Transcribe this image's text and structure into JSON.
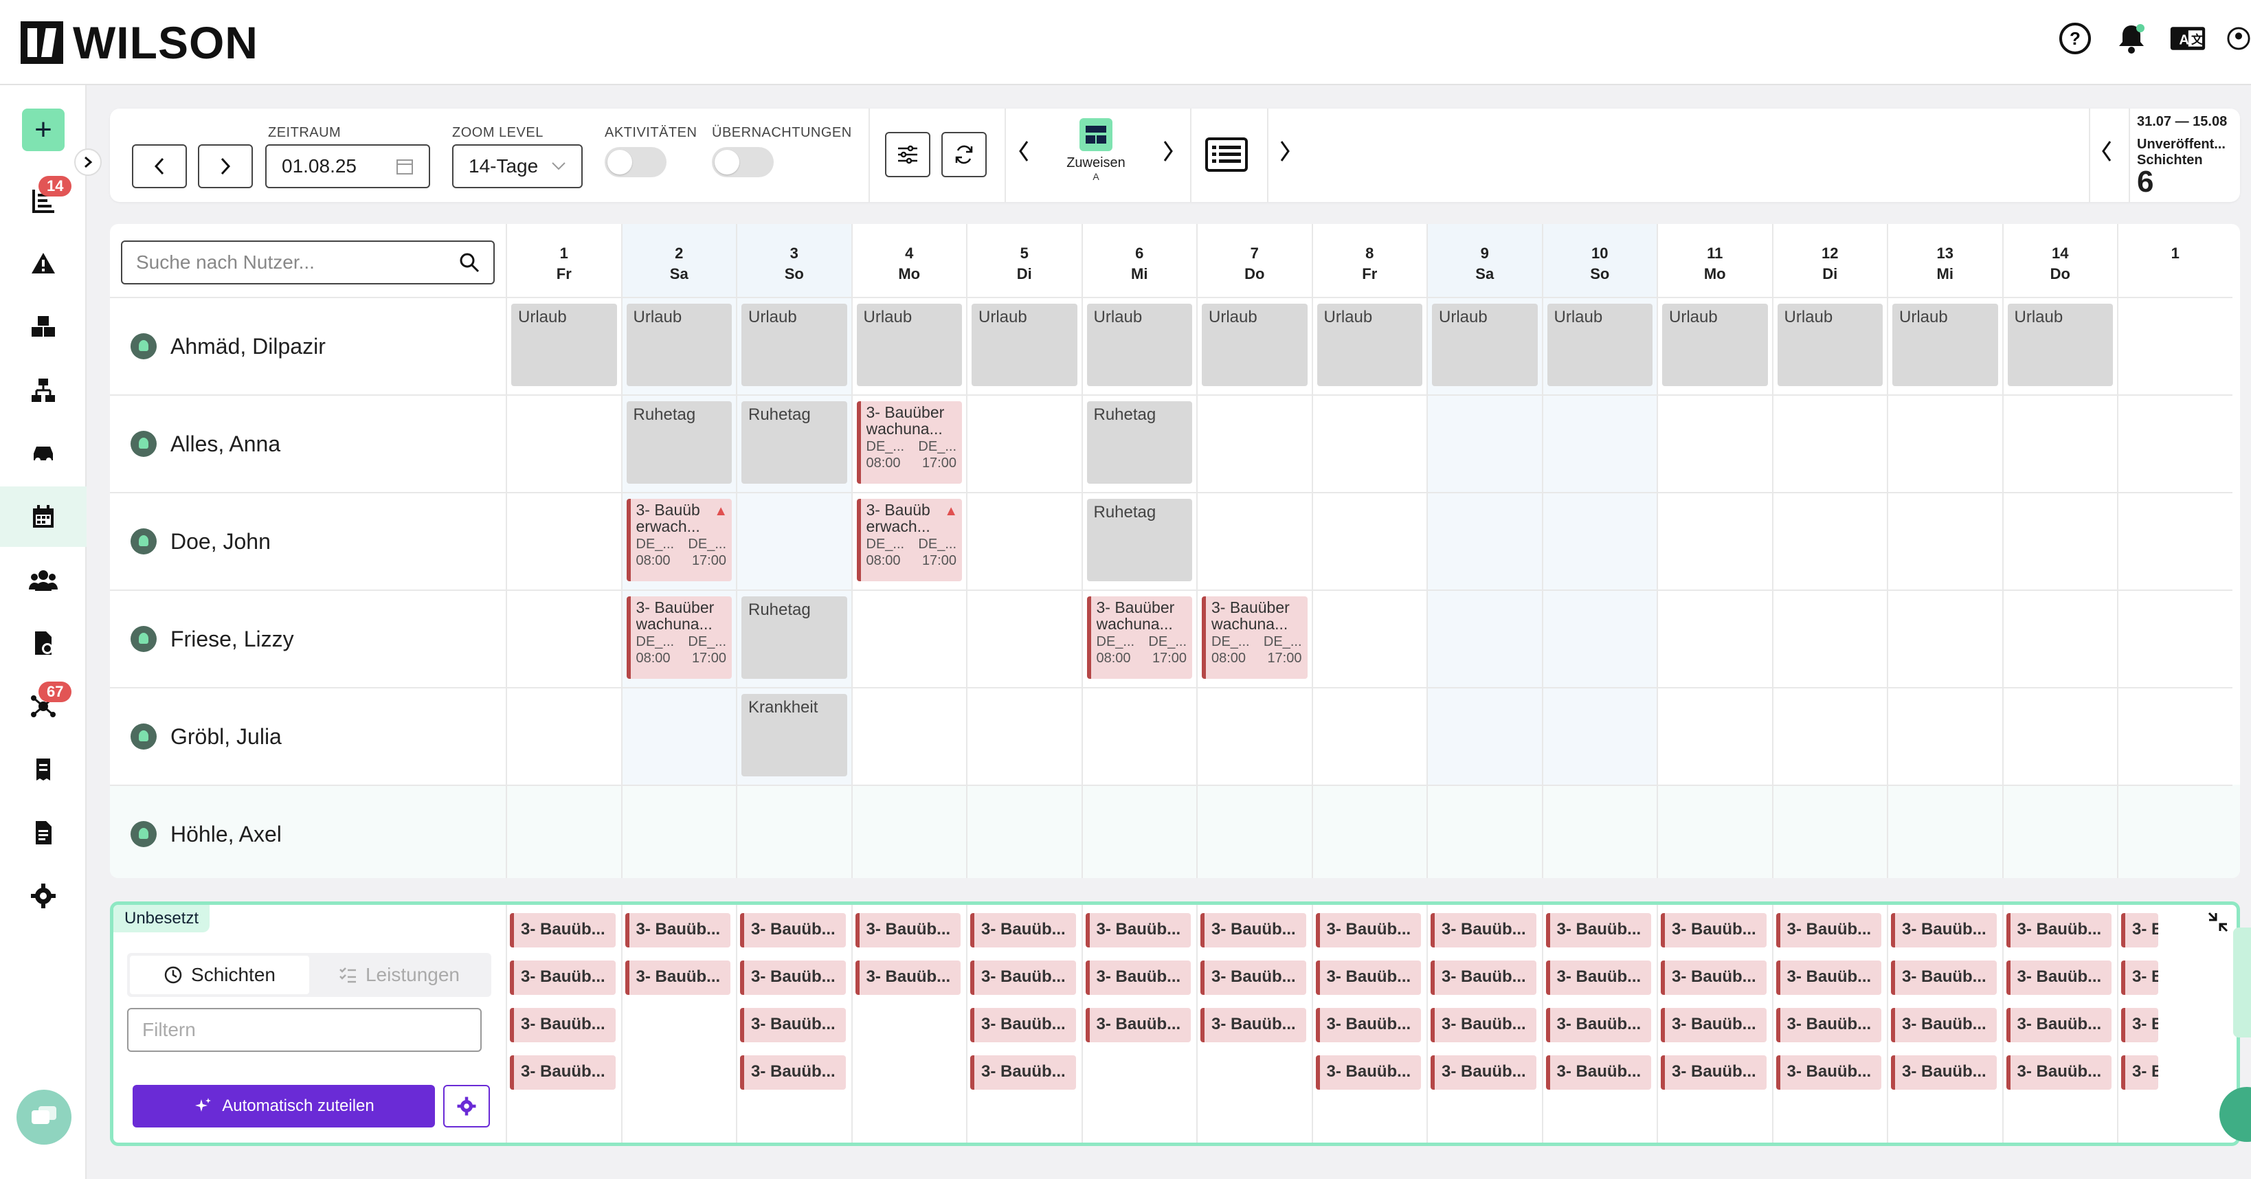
{
  "brand": {
    "name": "WILSON"
  },
  "header": {
    "icons": [
      "help-icon",
      "bell-icon",
      "translate-icon",
      "user-icon"
    ]
  },
  "sidebar": {
    "add_label": "+",
    "badges": {
      "timesheets": "14",
      "connections": "67"
    }
  },
  "toolbar": {
    "zeitraum_label": "ZEITRAUM",
    "zeitraum_value": "01.08.25",
    "zoom_label": "ZOOM LEVEL",
    "zoom_value": "14-Tage",
    "aktivitaeten_label": "AKTIVITÄTEN",
    "uebernachtungen_label": "ÜBERNACHTUNGEN",
    "zuweisen_label": "Zuweisen",
    "zuweisen_sub": "A",
    "period_range": "31.07 — 15.08",
    "unpublished_label": "Unveröffent...",
    "unpublished_sub": "Schichten",
    "unpublished_count": "6"
  },
  "grid": {
    "search_placeholder": "Suche nach Nutzer...",
    "days": [
      {
        "num": "1",
        "wd": "Fr",
        "we": false
      },
      {
        "num": "2",
        "wd": "Sa",
        "we": true
      },
      {
        "num": "3",
        "wd": "So",
        "we": true
      },
      {
        "num": "4",
        "wd": "Mo",
        "we": false
      },
      {
        "num": "5",
        "wd": "Di",
        "we": false
      },
      {
        "num": "6",
        "wd": "Mi",
        "we": false
      },
      {
        "num": "7",
        "wd": "Do",
        "we": false
      },
      {
        "num": "8",
        "wd": "Fr",
        "we": false
      },
      {
        "num": "9",
        "wd": "Sa",
        "we": true
      },
      {
        "num": "10",
        "wd": "So",
        "we": true
      },
      {
        "num": "11",
        "wd": "Mo",
        "we": false
      },
      {
        "num": "12",
        "wd": "Di",
        "we": false
      },
      {
        "num": "13",
        "wd": "Mi",
        "we": false
      },
      {
        "num": "14",
        "wd": "Do",
        "we": false
      },
      {
        "num": "1",
        "wd": "",
        "we": false
      }
    ],
    "users": [
      {
        "name": "Ahmäd, Dilpazir"
      },
      {
        "name": "Alles, Anna"
      },
      {
        "name": "Doe, John"
      },
      {
        "name": "Friese, Lizzy"
      },
      {
        "name": "Gröbl, Julia"
      },
      {
        "name": "Höhle, Axel"
      }
    ],
    "labels": {
      "urlaub": "Urlaub",
      "ruhetag": "Ruhetag",
      "krankheit": "Krankheit",
      "shift_title_a": "3- Bauüber wachuna...",
      "shift_title_b": "3- Bauüb erwach...",
      "shift_loc": "DE_...",
      "shift_start": "08:00",
      "shift_end": "17:00"
    }
  },
  "unbesetzt": {
    "title": "Unbesetzt",
    "tab_schichten": "Schichten",
    "tab_leistungen": "Leistungen",
    "filter_placeholder": "Filtern",
    "auto_button": "Automatisch zuteilen",
    "chip_label": "3- Bauüb...",
    "chip_partial": "3- B",
    "chip_partial2": "3- Ba"
  }
}
